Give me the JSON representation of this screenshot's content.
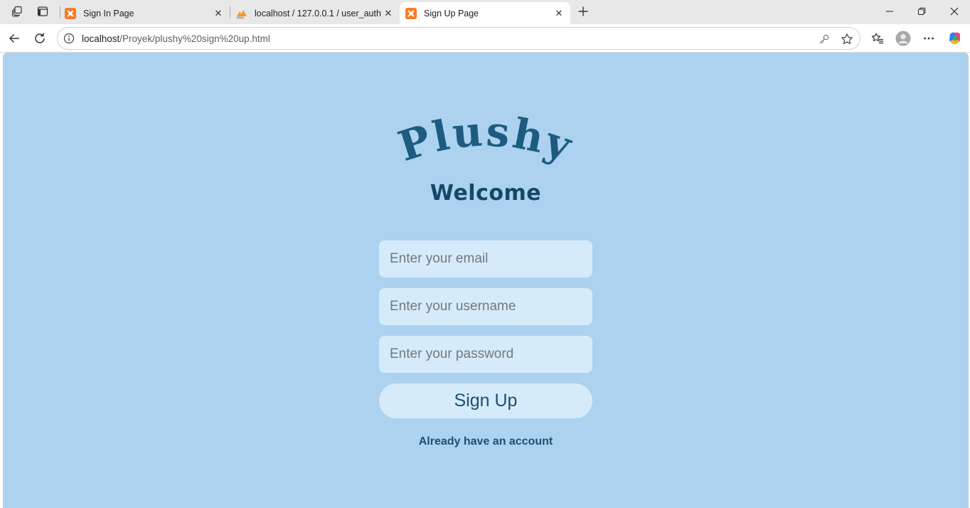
{
  "browser": {
    "tabs": [
      {
        "title": "Sign In Page",
        "active": false,
        "icon": "xampp-icon"
      },
      {
        "title": "localhost / 127.0.0.1 / user_auth /",
        "active": false,
        "icon": "phpmyadmin-icon"
      },
      {
        "title": "Sign Up Page",
        "active": true,
        "icon": "xampp-icon"
      }
    ],
    "address": {
      "host": "localhost",
      "path": "/Proyek/plushy%20sign%20up.html"
    }
  },
  "page": {
    "logo_text": "Plushy",
    "heading": "Welcome",
    "email_placeholder": "Enter your email",
    "username_placeholder": "Enter your username",
    "password_placeholder": "Enter your password",
    "submit_label": "Sign Up",
    "signin_link": "Already have an account"
  },
  "colors": {
    "page_background": "#acd2f0",
    "field_background": "#d6ebf9",
    "logo_color": "#1d5b80",
    "heading_color": "#174767",
    "link_color": "#1d4f73"
  }
}
